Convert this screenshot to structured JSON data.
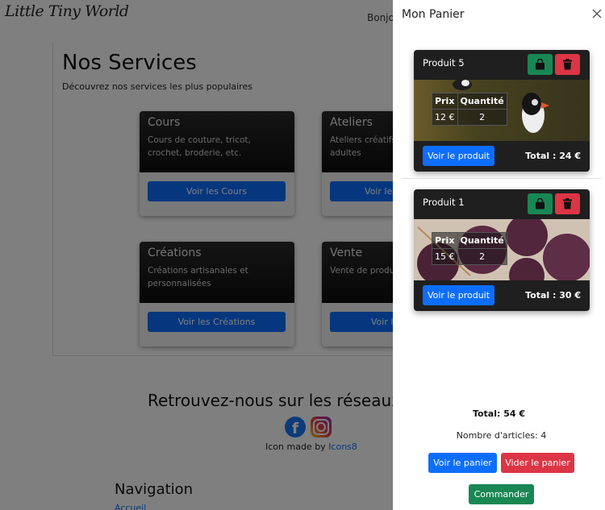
{
  "header": {
    "logo_text": "Little Tiny World",
    "nav_greeting": "Bonjour"
  },
  "services": {
    "title": "Nos Services",
    "subtitle": "Découvrez nos services les plus populaires",
    "cards": [
      {
        "title": "Cours",
        "desc": "Cours de couture, tricot, crochet, broderie, etc.",
        "button": "Voir les Cours"
      },
      {
        "title": "Ateliers",
        "desc": "Ateliers créatifs pour enfants et adultes",
        "button": "Voir les Ateliers"
      },
      {
        "title": "Créations",
        "desc": "Créations artisanales et personnalisées",
        "button": "Voir les Créations"
      },
      {
        "title": "Vente",
        "desc": "Vente de produits et matériels",
        "button": "Voir la Vente"
      }
    ]
  },
  "social": {
    "title": "Retrouvez-nous sur les réseaux sociaux",
    "credit_prefix": "Icon made by",
    "credit_link": "Icons8"
  },
  "navigation": {
    "title": "Navigation",
    "first_link": "Accueil"
  },
  "cart": {
    "title": "Mon Panier",
    "items": [
      {
        "name": "Produit 5",
        "price_header": "Prix",
        "qty_header": "Quantité",
        "price": "12 €",
        "qty": "2",
        "view_button": "Voir le produit",
        "total": "Total : 24 €",
        "image": "puffin-photo"
      },
      {
        "name": "Produit 1",
        "price_header": "Prix",
        "qty_header": "Quantité",
        "price": "15 €",
        "qty": "2",
        "view_button": "Voir le produit",
        "total": "Total : 30 €",
        "image": "yarn-photo"
      }
    ],
    "grand_total": "Total: 54 €",
    "article_count": "Nombre d'articles: 4",
    "view_cart": "Voir le panier",
    "empty_cart": "Vider le panier",
    "order": "Commander"
  },
  "colors": {
    "primary": "#0d6efd",
    "success": "#198754",
    "danger": "#dc3545"
  }
}
